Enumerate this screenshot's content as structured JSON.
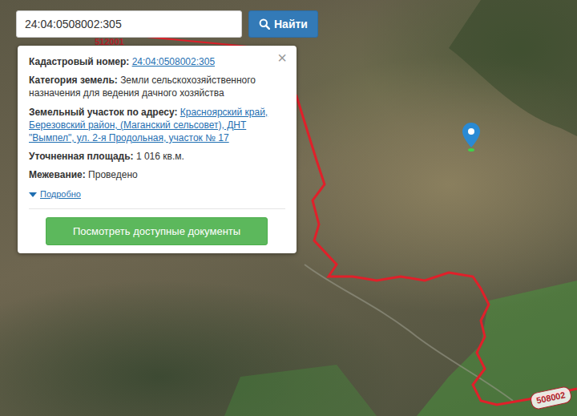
{
  "search": {
    "value": "24:04:0508002:305",
    "button": "Найти"
  },
  "popup": {
    "close": "×",
    "fields": [
      {
        "label": "Кадастровый номер:",
        "value": "24:04:0508002:305",
        "kind": "link"
      },
      {
        "label": "Категория земель:",
        "value": "Земли сельскохозяйственного назначения для ведения дачного хозяйства",
        "kind": "text"
      },
      {
        "label": "Земельный участок по адресу:",
        "value": "Красноярский край, Березовский район, (Маганский сельсовет), ДНТ \"Вымпел\", ул. 2-я Продольная, участок № 17",
        "kind": "link"
      },
      {
        "label": "Уточненная площадь:",
        "value": "1 016 кв.м.",
        "kind": "text"
      },
      {
        "label": "Межевание:",
        "value": "Проведено",
        "kind": "text"
      }
    ],
    "details": "Подробно",
    "button": "Посмотреть доступные документы"
  },
  "map": {
    "labels": [
      {
        "text": "512001",
        "kind": "plain"
      },
      {
        "text": "508002",
        "kind": "boxed"
      }
    ]
  }
}
